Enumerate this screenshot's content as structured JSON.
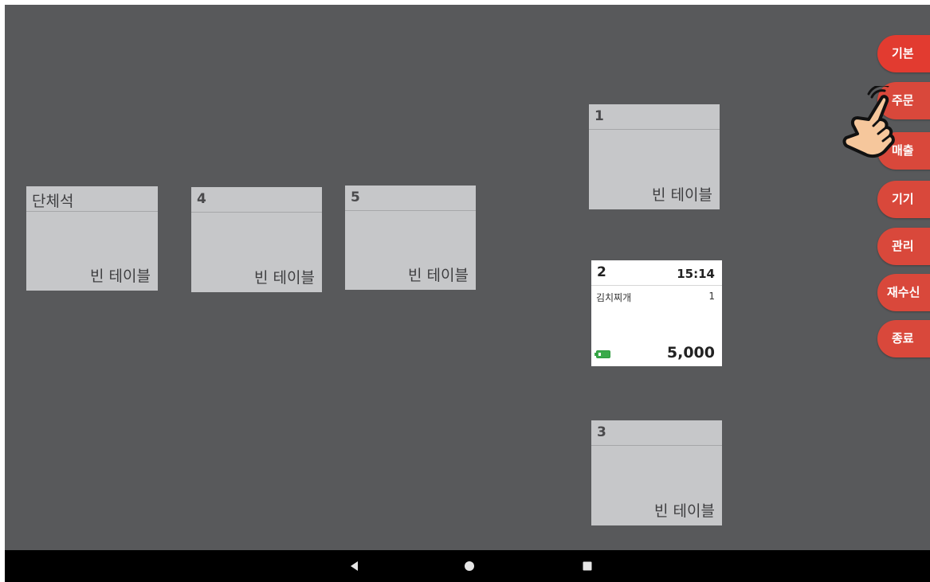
{
  "tables": {
    "group": {
      "name": "단체석",
      "status": "빈 테이블"
    },
    "t4": {
      "name": "4",
      "status": "빈 테이블"
    },
    "t5": {
      "name": "5",
      "status": "빈 테이블"
    },
    "t1": {
      "name": "1",
      "status": "빈 테이블"
    },
    "t2": {
      "name": "2",
      "time": "15:14",
      "item_name": "김치찌개",
      "item_qty": "1",
      "total": "5,000",
      "battery_icon": "battery-low-icon"
    },
    "t3": {
      "name": "3",
      "status": "빈 테이블"
    }
  },
  "side_menu": {
    "basic": "기본",
    "order": "주문",
    "sales": "매출",
    "device": "기기",
    "manage": "관리",
    "resend": "재수신",
    "exit": "종료"
  },
  "nav": {
    "back_icon": "back-triangle-icon",
    "home_icon": "home-circle-icon",
    "recent_icon": "recent-square-icon"
  },
  "overlay": {
    "icon": "tap-hand-icon"
  },
  "colors": {
    "background": "#58595b",
    "empty_table": "#c6c7c9",
    "active_table": "#ffffff",
    "menu_button": "#d9483b",
    "nav_bar": "#000000",
    "battery": "#3aaa4a"
  }
}
